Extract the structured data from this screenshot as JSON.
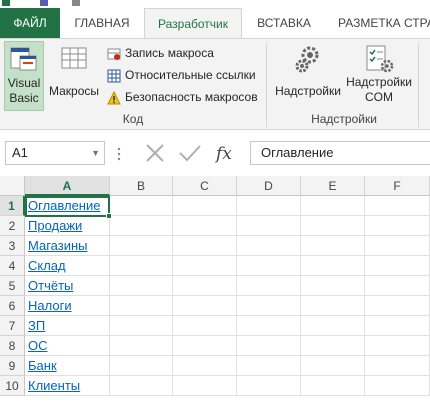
{
  "tabs": [
    {
      "label": "ФАЙЛ"
    },
    {
      "label": "ГЛАВНАЯ"
    },
    {
      "label": "Разработчик"
    },
    {
      "label": "ВСТАВКА"
    },
    {
      "label": "РАЗМЕТКА СТРА"
    }
  ],
  "ribbon": {
    "visual_basic_line1": "Visual",
    "visual_basic_line2": "Basic",
    "macros": "Макросы",
    "record_macro": "Запись макроса",
    "relative_refs": "Относительные ссылки",
    "macro_security": "Безопасность макросов",
    "group_code": "Код",
    "addins": "Надстройки",
    "com_addins_line1": "Надстройки",
    "com_addins_line2": "COM",
    "group_addins": "Надстройки"
  },
  "formula_bar": {
    "name_box": "A1",
    "formula": "Оглавление"
  },
  "grid": {
    "columns": [
      "A",
      "B",
      "C",
      "D",
      "E",
      "F"
    ],
    "rows": [
      {
        "num": "1",
        "a": "Оглавление"
      },
      {
        "num": "2",
        "a": "Продажи"
      },
      {
        "num": "3",
        "a": "Магазины"
      },
      {
        "num": "4",
        "a": "Склад"
      },
      {
        "num": "5",
        "a": "Отчёты"
      },
      {
        "num": "6",
        "a": "Налоги"
      },
      {
        "num": "7",
        "a": "ЗП"
      },
      {
        "num": "8",
        "a": "ОС"
      },
      {
        "num": "9",
        "a": "Банк"
      },
      {
        "num": "10",
        "a": "Клиенты"
      }
    ]
  },
  "colors": {
    "accent": "#217346",
    "link": "#0563c1"
  }
}
